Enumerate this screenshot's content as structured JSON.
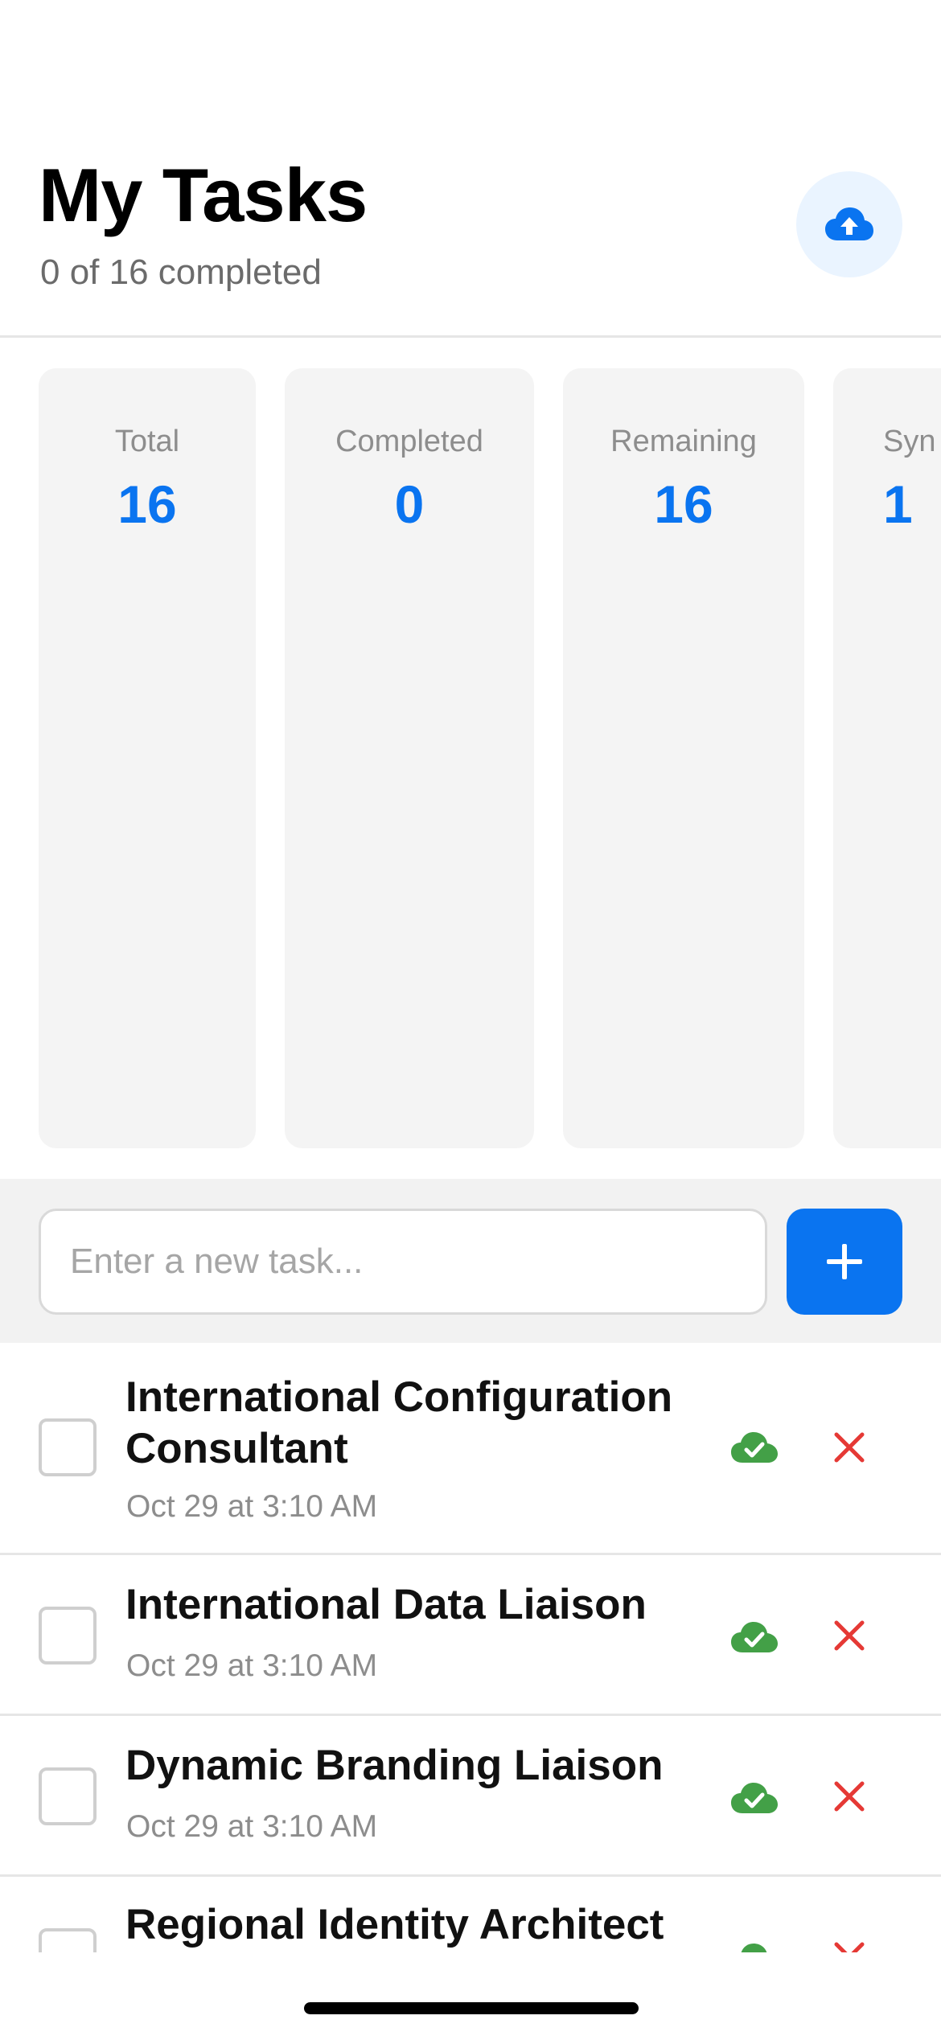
{
  "header": {
    "title": "My Tasks",
    "subtitle": "0 of 16 completed",
    "sync_icon": "cloud-upload-icon"
  },
  "stats": [
    {
      "label": "Total",
      "value": "16"
    },
    {
      "label": "Completed",
      "value": "0"
    },
    {
      "label": "Remaining",
      "value": "16"
    },
    {
      "label": "Syn",
      "value": "1"
    }
  ],
  "input": {
    "placeholder": "Enter a new task...",
    "add_icon": "plus-icon"
  },
  "tasks": [
    {
      "title": "International Configuration Consultant",
      "date": "Oct 29 at 3:10 AM",
      "sync_icon": "cloud-check-icon",
      "delete_icon": "close-icon"
    },
    {
      "title": "International Data Liaison",
      "date": "Oct 29 at 3:10 AM",
      "sync_icon": "cloud-check-icon",
      "delete_icon": "close-icon"
    },
    {
      "title": "Dynamic Branding Liaison",
      "date": "Oct 29 at 3:10 AM",
      "sync_icon": "cloud-check-icon",
      "delete_icon": "close-icon"
    },
    {
      "title": "Regional Identity Architect",
      "date": "",
      "sync_icon": "cloud-check-icon",
      "delete_icon": "close-icon"
    }
  ],
  "colors": {
    "accent": "#0a74f0",
    "synced": "#43a047",
    "delete": "#e53935",
    "card_bg": "#f4f4f4"
  }
}
